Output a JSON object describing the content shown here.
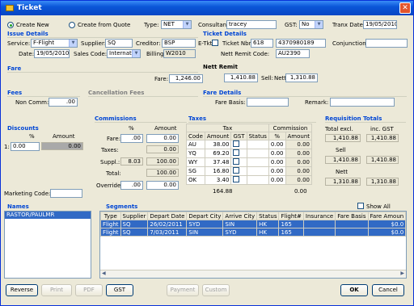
{
  "window": {
    "title": "Ticket",
    "close": "✕"
  },
  "top": {
    "create_new": "Create New",
    "create_from_quote": "Create from Quote",
    "type_label": "Type:",
    "type_value": "NET",
    "consultant_label": "Consultant:",
    "consultant_value": "tracey",
    "gst_label": "GST:",
    "gst_value": "No",
    "tranx_date_label": "Tranx Date:",
    "tranx_date_value": "19/05/2010"
  },
  "issue": {
    "title": "Issue Details",
    "service_label": "Service:",
    "service_value": "F-Flight",
    "supplier_label": "Supplier:",
    "supplier_value": "SQ",
    "creditor_label": "Creditor:",
    "creditor_value": "BSP",
    "date_label": "Date:",
    "date_value": "19/05/2010",
    "sales_code_label": "Sales Code:",
    "sales_code_value": "Internat",
    "billing_label": "Billing:",
    "billing_value": "W2010"
  },
  "ticket": {
    "title": "Ticket Details",
    "etkt_label": "E-Tkt",
    "ticket_nbr_label": "Ticket Nbr:",
    "ticket_prefix": "618",
    "ticket_nbr": "4370980189",
    "conjunction_label": "Conjunction:",
    "nett_remit_code_label": "Nett Remit Code:",
    "nett_remit_code": "AU2390"
  },
  "fare": {
    "title": "Fare",
    "fare_label": "Fare:",
    "fare_value": "1,246.00"
  },
  "nett_remit": {
    "title": "Nett Remit",
    "value": "1,410.88",
    "sell_label": "Sell:",
    "nett_label": "Nett:",
    "nett_value": "1,310.88"
  },
  "fees": {
    "title": "Fees",
    "non_comm_label": "Non Comm:",
    "non_comm_value": ".00"
  },
  "cancellation": {
    "title": "Cancellation Fees"
  },
  "fare_details": {
    "title": "Fare Details",
    "basis_label": "Fare Basis:",
    "remark_label": "Remark:"
  },
  "discounts": {
    "title": "Discounts",
    "col_pct": "%",
    "col_amount": "Amount",
    "row_label": "1:",
    "pct": "0.00",
    "amount": "0.00"
  },
  "commissions": {
    "title": "Commissions",
    "col_pct": "%",
    "col_amount": "Amount",
    "fare_label": "Fare:",
    "fare_pct": ".00",
    "fare_amount": "0.00",
    "taxes_label": "Taxes:",
    "taxes_amount": "0.00",
    "suppl_label": "Suppl.:",
    "suppl_pct": "8.03",
    "suppl_amount": "100.00",
    "total_label": "Total:",
    "total_amount": "100.00",
    "override_label": "Override:",
    "override_pct": ".00",
    "override_amount": "0.00"
  },
  "taxes": {
    "title": "Taxes",
    "group_tax": "Tax",
    "group_comm": "Commission",
    "col_code": "Code",
    "col_amount": "Amount",
    "col_gst": "GST",
    "col_status": "Status",
    "col_pct": "%",
    "col_comm_amount": "Amount",
    "rows": [
      {
        "code": "AU",
        "amount": "38.00",
        "pct": "0.00",
        "comm": "0.00"
      },
      {
        "code": "YQ",
        "amount": "69.20",
        "pct": "0.00",
        "comm": "0.00"
      },
      {
        "code": "WY",
        "amount": "37.48",
        "pct": "0.00",
        "comm": "0.00"
      },
      {
        "code": "SG",
        "amount": "16.80",
        "pct": "0.00",
        "comm": "0.00"
      },
      {
        "code": "OK",
        "amount": "3.40",
        "pct": "0.00",
        "comm": "0.00"
      }
    ],
    "total": "164.88",
    "comm_total": "0.00"
  },
  "requisition": {
    "title": "Requisition Totals",
    "total_excl_label": "Total excl.",
    "inc_gst_label": "inc. GST",
    "total_excl": "1,410.88",
    "total_inc": "1,410.88",
    "sell_label": "Sell",
    "sell_excl": "1,410.88",
    "sell_inc": "1,410.88",
    "nett_label": "Nett",
    "nett_excl": "1,310.88",
    "nett_inc": "1,310.88"
  },
  "marketing": {
    "label": "Marketing Code:"
  },
  "names": {
    "title": "Names",
    "items": [
      "RASTOR/PAULMR"
    ]
  },
  "segments": {
    "title": "Segments",
    "show_all": "Show All",
    "columns": [
      "Type",
      "Supplier",
      "Depart Date",
      "Depart City",
      "Arrive City",
      "Status",
      "Flight#",
      "Insurance",
      "Fare Basis",
      "Fare Amoun"
    ],
    "rows": [
      [
        "Flight",
        "SQ",
        "26/02/2011",
        "SYD",
        "SIN",
        "HK",
        "165",
        "",
        "",
        "$0.0"
      ],
      [
        "Flight",
        "SQ",
        "7/03/2011",
        "SIN",
        "SYD",
        "HK",
        "165",
        "",
        "",
        "$0.0"
      ]
    ]
  },
  "buttons": {
    "reverse": "Reverse",
    "print": "Print",
    "pdf": "PDF",
    "gst": "GST",
    "payment": "Payment",
    "custom": "Custom",
    "ok": "OK",
    "cancel": "Cancel"
  },
  "colors": {
    "accent": "#0046d5",
    "titlebar": "#0a56d8",
    "selection": "#316ac5"
  }
}
